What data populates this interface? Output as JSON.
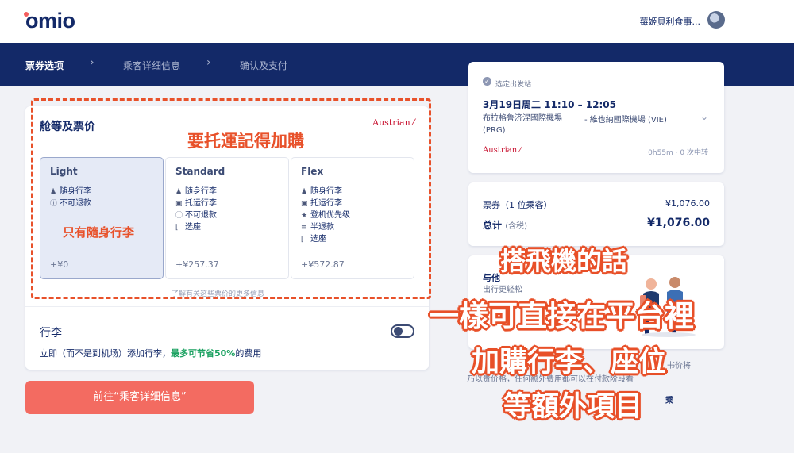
{
  "header": {
    "logo_text": "omio",
    "user_name": "莓姬貝利食事..."
  },
  "steps": [
    {
      "label": "票券选项"
    },
    {
      "label": "乘客详细信息"
    },
    {
      "label": "确认及支付"
    }
  ],
  "fare_section": {
    "title": "舱等及票价",
    "airline": "Austrian",
    "options": [
      {
        "name": "Light",
        "features": [
          {
            "icon": "bag-icon",
            "glyph": "♟",
            "text": "随身行李"
          },
          {
            "icon": "info-icon",
            "glyph": "ⓘ",
            "text": "不可退款"
          }
        ],
        "price": "+¥0"
      },
      {
        "name": "Standard",
        "features": [
          {
            "icon": "bag-icon",
            "glyph": "♟",
            "text": "随身行李"
          },
          {
            "icon": "suitcase-icon",
            "glyph": "▣",
            "text": "托运行李"
          },
          {
            "icon": "info-icon",
            "glyph": "ⓘ",
            "text": "不可退款"
          },
          {
            "icon": "seat-icon",
            "glyph": "⌊",
            "text": "选座"
          }
        ],
        "price": "+¥257.37"
      },
      {
        "name": "Flex",
        "features": [
          {
            "icon": "bag-icon",
            "glyph": "♟",
            "text": "随身行李"
          },
          {
            "icon": "suitcase-icon",
            "glyph": "▣",
            "text": "托运行李"
          },
          {
            "icon": "star-icon",
            "glyph": "★",
            "text": "登机优先级"
          },
          {
            "icon": "refund-icon",
            "glyph": "≡",
            "text": "半退款"
          },
          {
            "icon": "seat-icon",
            "glyph": "⌊",
            "text": "选座"
          }
        ],
        "price": "+¥572.87"
      }
    ],
    "more_info": "了解有关这些票价的更多信息"
  },
  "luggage": {
    "title": "行李",
    "desc_prefix": "立即（而不是到机场）添加行李，",
    "desc_highlight": "最多可节省50%",
    "desc_suffix": "的费用"
  },
  "cta_label": "前往“乘客详细信息”",
  "trip": {
    "selected_label": "选定出发站",
    "date_time": "3月19日周二   11:10 – 12:05",
    "origin": "布拉格鲁济涅國際機場",
    "origin_code": "(PRG)",
    "dest": "-   維也納國際機場 (VIE)",
    "airline": "Austrian",
    "duration": "0h55m · 0 次中转"
  },
  "price_summary": {
    "ticket_label": "票券（1 位乘客）",
    "ticket_price": "¥1,076.00",
    "total_label": "总计",
    "total_tax": "(含税)",
    "total_price": "¥1,076.00"
  },
  "promo": {
    "title": "与他",
    "sub": "出行更轻松"
  },
  "fineprint": {
    "line1": "书价将",
    "line2": "乃以贵价格，任何额外费用都可以在付款阶段看",
    "line3": "乘"
  },
  "annotations": {
    "top": "要托運記得加購",
    "light": "只有隨身行李",
    "line1": "搭飛機的話",
    "line2": "一樣可直接在平台裡",
    "line3": "加購行李、座位",
    "line4": "等額外項目"
  },
  "colors": {
    "navy": "#132968",
    "cta": "#f36b61",
    "annotation": "#e8512a",
    "airline_red": "#c8102e",
    "savings_green": "#1aa160"
  }
}
